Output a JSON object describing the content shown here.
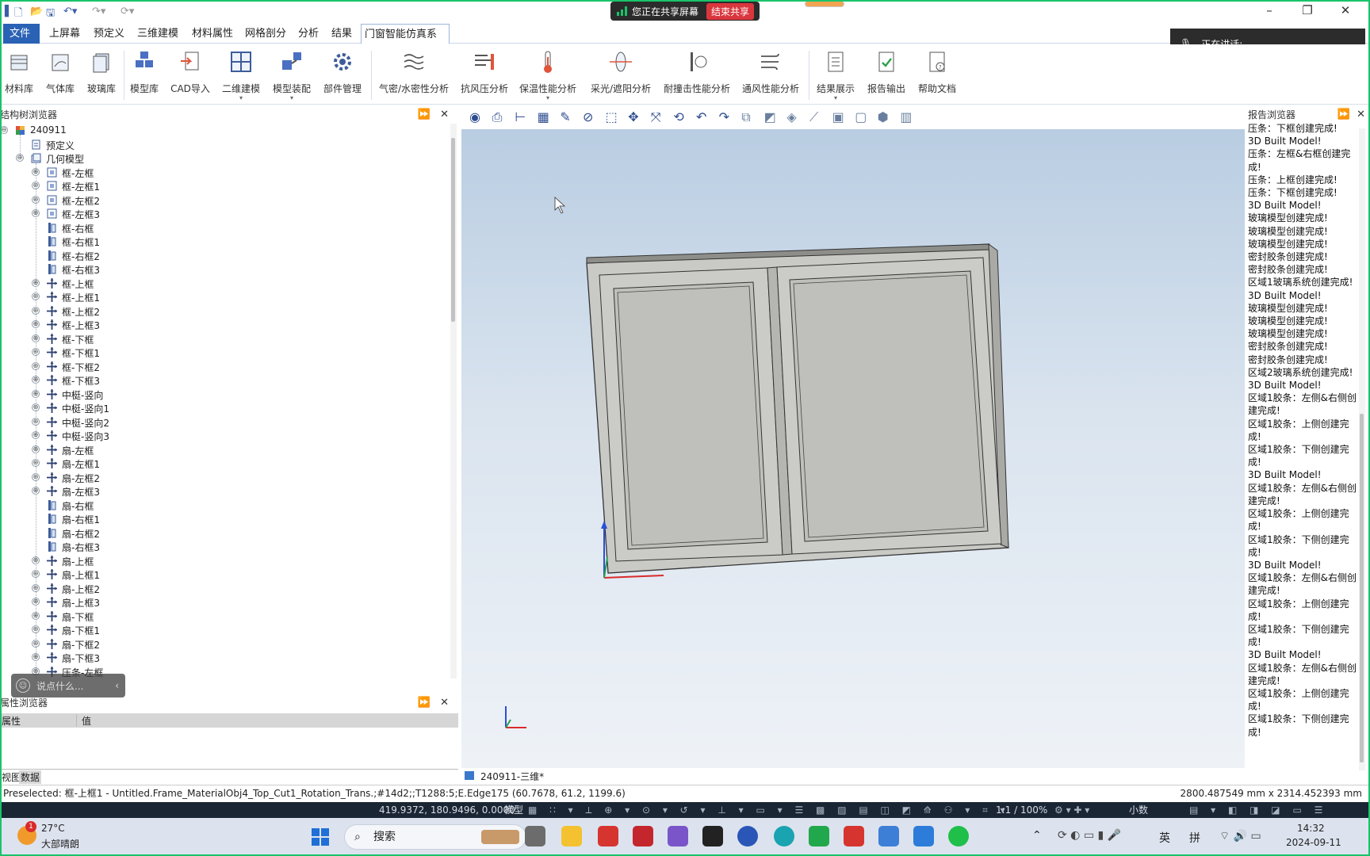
{
  "menu": {
    "file": "文件",
    "items": [
      "上屏幕",
      "预定义",
      "三维建模",
      "材料属性",
      "网格剖分",
      "分析",
      "结果",
      "门窗智能仿真系统"
    ]
  },
  "share": {
    "status": "您正在共享屏幕",
    "stop": "结束共享"
  },
  "speaking": {
    "label": "正在讲话:"
  },
  "ribbon": {
    "buttons": [
      "材料库",
      "气体库",
      "玻璃库",
      "模型库",
      "CAD导入",
      "二维建模",
      "模型装配",
      "部件管理",
      "气密/水密性分析",
      "抗风压分析",
      "保温性能分析",
      "采光/遮阳分析",
      "耐撞击性能分析",
      "通风性能分析",
      "结果展示",
      "报告输出",
      "帮助文档"
    ]
  },
  "structure_browser": {
    "title": "结构树浏览器",
    "root": "240911",
    "predef": "预定义",
    "geom": "几何模型",
    "nodes": [
      "框-左框",
      "框-左框1",
      "框-左框2",
      "框-左框3",
      "框-右框",
      "框-右框1",
      "框-右框2",
      "框-右框3",
      "框-上框",
      "框-上框1",
      "框-上框2",
      "框-上框3",
      "框-下框",
      "框-下框1",
      "框-下框2",
      "框-下框3",
      "中梃-竖向",
      "中梃-竖向1",
      "中梃-竖向2",
      "中梃-竖向3",
      "扇-左框",
      "扇-左框1",
      "扇-左框2",
      "扇-左框3",
      "扇-右框",
      "扇-右框1",
      "扇-右框2",
      "扇-右框3",
      "扇-上框",
      "扇-上框1",
      "扇-上框2",
      "扇-上框3",
      "扇-下框",
      "扇-下框1",
      "扇-下框2",
      "扇-下框3",
      "压条-左框"
    ]
  },
  "chat_input": {
    "placeholder": "说点什么..."
  },
  "property_browser": {
    "title": "属性浏览器",
    "col_attr": "属性",
    "col_value": "值"
  },
  "bottom_tabs": [
    "视图",
    "数据"
  ],
  "viewport": {
    "tab_label": "240911-三维*"
  },
  "report_browser": {
    "title": "报告浏览器",
    "lines": [
      "压条：下框创建完成!",
      "3D Built Model!",
      "压条：左框&右框创建完成!",
      "压条：上框创建完成!",
      "压条：下框创建完成!",
      "3D Built Model!",
      "玻璃模型创建完成!",
      "玻璃模型创建完成!",
      "玻璃模型创建完成!",
      "密封胶条创建完成!",
      "密封胶条创建完成!",
      "区域1玻璃系统创建完成!",
      "3D Built Model!",
      "玻璃模型创建完成!",
      "玻璃模型创建完成!",
      "玻璃模型创建完成!",
      "密封胶条创建完成!",
      "密封胶条创建完成!",
      "区域2玻璃系统创建完成!",
      "3D Built Model!",
      "区域1胶条：左侧&右侧创建完成!",
      "区域1胶条：上侧创建完成!",
      "区域1胶条：下侧创建完成!",
      "3D Built Model!",
      "区域1胶条：左侧&右侧创建完成!",
      "区域1胶条：上侧创建完成!",
      "区域1胶条：下侧创建完成!",
      "3D Built Model!",
      "区域1胶条：左侧&右侧创建完成!",
      "区域1胶条：上侧创建完成!",
      "区域1胶条：下侧创建完成!",
      "3D Built Model!",
      "区域1胶条：左侧&右侧创建完成!",
      "区域1胶条：上侧创建完成!",
      "区域1胶条：下侧创建完成!"
    ]
  },
  "status": {
    "preselected": "Preselected: 框-上框1 - Untitled.Frame_MaterialObj4_Top_Cut1_Rotation_Trans.;#14d2;;T1288:5;E.Edge175 (60.7678, 61.2, 1199.6)",
    "dimensions": "2800.487549 mm x 2314.452393 mm",
    "coords": "419.9372, 180.9496, 0.0000",
    "mode": "模型",
    "zoom": "1:1 / 100%",
    "decimal": "小数"
  },
  "taskbar": {
    "weather_temp": "27°C",
    "weather_desc": "大部晴朗",
    "search": "搜索",
    "ime": "英",
    "ime2": "拼",
    "time": "14:32",
    "date": "2024-09-11",
    "badge": "1"
  }
}
